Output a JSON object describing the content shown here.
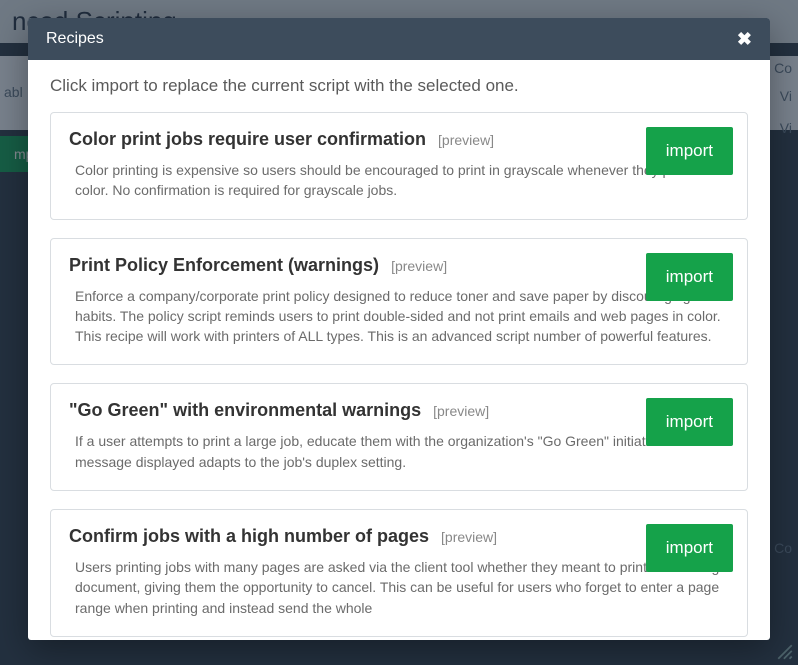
{
  "background": {
    "page_title_fragment": "nced Scripting",
    "tab_fragment": "abl",
    "button_fragment": "mp",
    "side_items": [
      "Co",
      "Vi",
      "Vi",
      "Co"
    ]
  },
  "modal": {
    "title": "Recipes",
    "intro": "Click import to replace the current script with the selected one.",
    "preview_label": "[preview]",
    "import_label": "import",
    "recipes": [
      {
        "title": "Color print jobs require user confirmation",
        "desc": "Color printing is expensive so users should be encouraged to print in grayscale whenever they print in color. No confirmation is required for grayscale jobs."
      },
      {
        "title": "Print Policy Enforcement (warnings)",
        "desc": "Enforce a company/corporate print policy designed to reduce toner and save paper by discouraging bad habits. The policy script reminds users to print double-sided and not print emails and web pages in color. This recipe will work with printers of ALL types. This is an advanced script number of powerful features."
      },
      {
        "title": "\"Go Green\" with environmental warnings",
        "desc": "If a user attempts to print a large job, educate them with the organization's \"Go Green\" initiative. The message displayed adapts to the job's duplex setting."
      },
      {
        "title": "Confirm jobs with a high number of pages",
        "desc": "Users printing jobs with many pages are asked via the client tool whether they meant to print such a large document, giving them the opportunity to cancel. This can be useful for users who forget to enter a page range when printing and instead send the whole"
      }
    ]
  }
}
